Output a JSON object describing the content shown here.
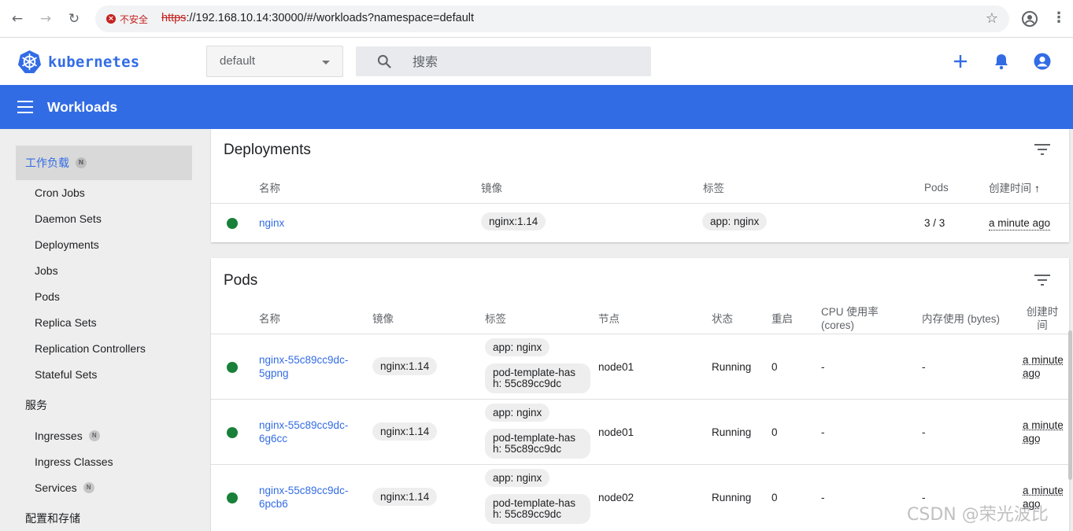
{
  "browser": {
    "insecure_label": "不安全",
    "url_scheme": "https",
    "url_rest": "://192.168.10.14:30000/#/workloads?namespace=default"
  },
  "app": {
    "brand": "kubernetes",
    "namespace": "default",
    "search_placeholder": "搜索",
    "page_title": "Workloads",
    "accent": "#326ce5"
  },
  "sidebar": {
    "workloads_heading": "工作负载",
    "badge": "N",
    "workload_items": [
      "Cron Jobs",
      "Daemon Sets",
      "Deployments",
      "Jobs",
      "Pods",
      "Replica Sets",
      "Replication Controllers",
      "Stateful Sets"
    ],
    "services_heading": "服务",
    "service_items": [
      "Ingresses",
      "Ingress Classes",
      "Services"
    ],
    "config_heading": "配置和存储"
  },
  "deployments": {
    "title": "Deployments",
    "columns": {
      "name": "名称",
      "image": "镜像",
      "labels": "标签",
      "pods": "Pods",
      "created": "创建时间"
    },
    "rows": [
      {
        "name": "nginx",
        "image": "nginx:1.14",
        "label": "app: nginx",
        "pods": "3 / 3",
        "created": "a minute ago"
      }
    ]
  },
  "pods": {
    "title": "Pods",
    "columns": {
      "name": "名称",
      "image": "镜像",
      "labels": "标签",
      "node": "节点",
      "status": "状态",
      "restarts": "重启",
      "cpu": "CPU 使用率 (cores)",
      "memory": "内存使用 (bytes)",
      "created": "创建时间"
    },
    "rows": [
      {
        "name": "nginx-55c89cc9dc-5gpng",
        "image": "nginx:1.14",
        "label1": "app: nginx",
        "label2": "pod-template-hash: 55c89cc9dc",
        "node": "node01",
        "status": "Running",
        "restarts": "0",
        "cpu": "-",
        "memory": "-",
        "created": "a minute ago"
      },
      {
        "name": "nginx-55c89cc9dc-6g6cc",
        "image": "nginx:1.14",
        "label1": "app: nginx",
        "label2": "pod-template-hash: 55c89cc9dc",
        "node": "node01",
        "status": "Running",
        "restarts": "0",
        "cpu": "-",
        "memory": "-",
        "created": "a minute ago"
      },
      {
        "name": "nginx-55c89cc9dc-6pcb6",
        "image": "nginx:1.14",
        "label1": "app: nginx",
        "label2": "pod-template-hash: 55c89cc9dc",
        "node": "node02",
        "status": "Running",
        "restarts": "0",
        "cpu": "-",
        "memory": "-",
        "created": "a minute ago"
      }
    ]
  },
  "watermark": "CSDN @荣光波比"
}
